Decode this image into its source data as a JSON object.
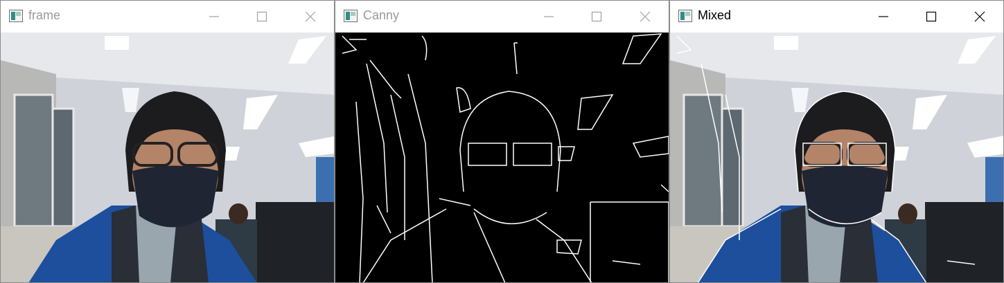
{
  "windows": [
    {
      "title": "frame",
      "active": false,
      "controls": [
        "minimize-icon",
        "maximize-icon",
        "close-icon"
      ],
      "view": "camera-frame"
    },
    {
      "title": "Canny",
      "active": false,
      "controls": [
        "minimize-icon",
        "maximize-icon",
        "close-icon"
      ],
      "view": "edge-map"
    },
    {
      "title": "Mixed",
      "active": true,
      "controls": [
        "minimize-icon",
        "maximize-icon",
        "close-icon"
      ],
      "view": "camera-frame-with-edges"
    }
  ],
  "colors": {
    "titlebar": "#ffffff",
    "title_inactive": "#9a9a9a",
    "title_active": "#000000",
    "edge_background": "#000000",
    "edge_line": "#ffffff",
    "jacket_blue": "#1d4f9c",
    "ceiling": "#d9dde2"
  }
}
